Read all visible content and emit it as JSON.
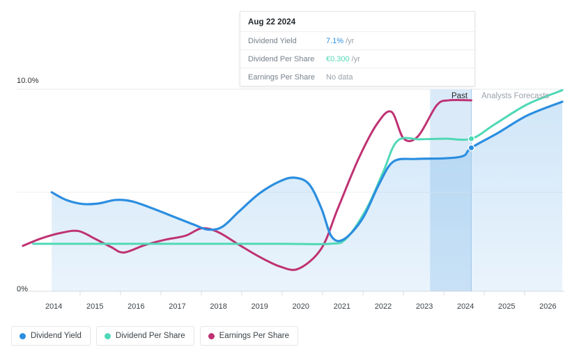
{
  "chart_data": {
    "type": "line",
    "title": "",
    "xlabel": "",
    "ylabel": "",
    "xlim": [
      2013.6,
      2026.9
    ],
    "ylim": [
      0,
      10
    ],
    "grid": true,
    "legend_position": "bottom-left",
    "y_ticks": [
      "0%",
      "10.0%"
    ],
    "x_ticks": [
      "2014",
      "2015",
      "2016",
      "2017",
      "2018",
      "2019",
      "2020",
      "2021",
      "2022",
      "2023",
      "2024",
      "2025",
      "2026"
    ],
    "divider_x": 2024.64,
    "divider_labels": {
      "past": "Past",
      "forecast": "Analysts Forecasts"
    },
    "series": [
      {
        "name": "Dividend Yield",
        "color": "#2b8ee0",
        "unit": "%",
        "area_fill": true,
        "points": [
          [
            2014.45,
            4.9
          ],
          [
            2014.8,
            4.52
          ],
          [
            2015.2,
            4.32
          ],
          [
            2015.6,
            4.35
          ],
          [
            2016.0,
            4.52
          ],
          [
            2016.4,
            4.45
          ],
          [
            2016.9,
            4.1
          ],
          [
            2017.4,
            3.7
          ],
          [
            2017.9,
            3.3
          ],
          [
            2018.25,
            3.05
          ],
          [
            2018.6,
            3.2
          ],
          [
            2019.0,
            3.95
          ],
          [
            2019.5,
            4.85
          ],
          [
            2020.0,
            5.45
          ],
          [
            2020.35,
            5.62
          ],
          [
            2020.7,
            5.3
          ],
          [
            2021.0,
            4.1
          ],
          [
            2021.25,
            2.7
          ],
          [
            2021.55,
            2.58
          ],
          [
            2022.0,
            3.6
          ],
          [
            2022.4,
            5.3
          ],
          [
            2022.75,
            6.42
          ],
          [
            2023.3,
            6.55
          ],
          [
            2024.0,
            6.58
          ],
          [
            2024.45,
            6.7
          ],
          [
            2024.64,
            7.1
          ],
          [
            2025.3,
            7.85
          ],
          [
            2026.0,
            8.7
          ],
          [
            2026.85,
            9.38
          ]
        ]
      },
      {
        "name": "Dividend Per Share",
        "color": "#4fd8b6",
        "unit": "€",
        "area_fill": false,
        "points": [
          [
            2014.0,
            2.35
          ],
          [
            2016.0,
            2.35
          ],
          [
            2018.0,
            2.35
          ],
          [
            2020.0,
            2.35
          ],
          [
            2021.2,
            2.35
          ],
          [
            2021.6,
            2.6
          ],
          [
            2022.1,
            4.1
          ],
          [
            2022.5,
            5.9
          ],
          [
            2022.85,
            7.45
          ],
          [
            2023.4,
            7.52
          ],
          [
            2024.0,
            7.55
          ],
          [
            2024.64,
            7.55
          ],
          [
            2025.2,
            8.25
          ],
          [
            2026.0,
            9.25
          ],
          [
            2026.85,
            9.95
          ]
        ]
      },
      {
        "name": "Earnings Per Share",
        "color": "#bf3272",
        "unit": "€",
        "area_fill": false,
        "points": [
          [
            2013.75,
            2.25
          ],
          [
            2014.2,
            2.62
          ],
          [
            2014.7,
            2.9
          ],
          [
            2015.1,
            2.98
          ],
          [
            2015.5,
            2.6
          ],
          [
            2015.9,
            2.18
          ],
          [
            2016.2,
            1.92
          ],
          [
            2016.7,
            2.28
          ],
          [
            2017.2,
            2.55
          ],
          [
            2017.7,
            2.75
          ],
          [
            2018.1,
            3.12
          ],
          [
            2018.5,
            2.92
          ],
          [
            2019.0,
            2.3
          ],
          [
            2019.5,
            1.7
          ],
          [
            2020.0,
            1.22
          ],
          [
            2020.45,
            1.12
          ],
          [
            2021.0,
            2.12
          ],
          [
            2021.4,
            4.1
          ],
          [
            2021.9,
            6.55
          ],
          [
            2022.35,
            8.28
          ],
          [
            2022.7,
            8.88
          ],
          [
            2023.0,
            7.55
          ],
          [
            2023.35,
            7.68
          ],
          [
            2023.8,
            9.2
          ],
          [
            2024.1,
            9.45
          ],
          [
            2024.64,
            9.45
          ]
        ]
      }
    ],
    "markers": [
      {
        "series": "Dividend Per Share",
        "x": 2024.64,
        "y": 7.55,
        "color": "#4fd8b6"
      },
      {
        "series": "Dividend Yield",
        "x": 2024.64,
        "y": 7.1,
        "color": "#2b8ee0"
      }
    ]
  },
  "tooltip": {
    "date": "Aug 22 2024",
    "rows": [
      {
        "label": "Dividend Yield",
        "value": "7.1%",
        "unit": "/yr",
        "value_color": "#2b8ee0"
      },
      {
        "label": "Dividend Per Share",
        "value": "€0.300",
        "unit": "/yr",
        "value_color": "#4fd8b6"
      },
      {
        "label": "Earnings Per Share",
        "value": "No data",
        "unit": "",
        "value_color": "#9aa2aa"
      }
    ]
  },
  "legend": {
    "items": [
      {
        "label": "Dividend Yield",
        "color": "#2b8ee0"
      },
      {
        "label": "Dividend Per Share",
        "color": "#4fd8b6"
      },
      {
        "label": "Earnings Per Share",
        "color": "#bf3272"
      }
    ]
  }
}
